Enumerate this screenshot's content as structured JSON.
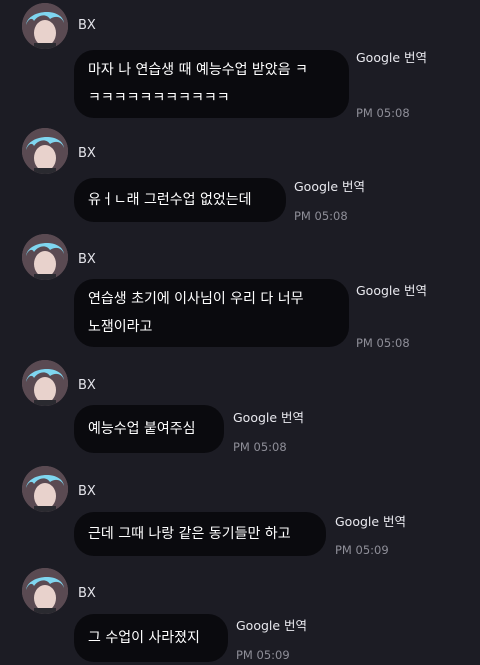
{
  "sender_name": "BX",
  "translate_label": "Google 번역",
  "messages": [
    {
      "text": "마자 나 연습생 때 예능수업 받았음 ㅋ\nㅋㅋㅋㅋㅋㅋㅋㅋㅋㅋㅋ",
      "time": "PM 05:08"
    },
    {
      "text": "유ㅓㄴ래 그런수업 없었는데",
      "time": "PM 05:08"
    },
    {
      "text": "연습생 초기에 이사님이 우리 다 너무\n노잼이라고",
      "time": "PM 05:08"
    },
    {
      "text": "예능수업 붙여주심",
      "time": "PM 05:08"
    },
    {
      "text": "근데 그때 나랑 같은 동기들만 하고",
      "time": "PM 05:09"
    },
    {
      "text": "그 수업이 사라졌지",
      "time": "PM 05:09"
    }
  ],
  "colors": {
    "background": "#1c1c24",
    "bubble": "#0a0a0e",
    "timestamp": "#8e8e98",
    "avatar_hair": "#7fd6f0"
  },
  "icons": {
    "avatar": "profile-photo"
  }
}
